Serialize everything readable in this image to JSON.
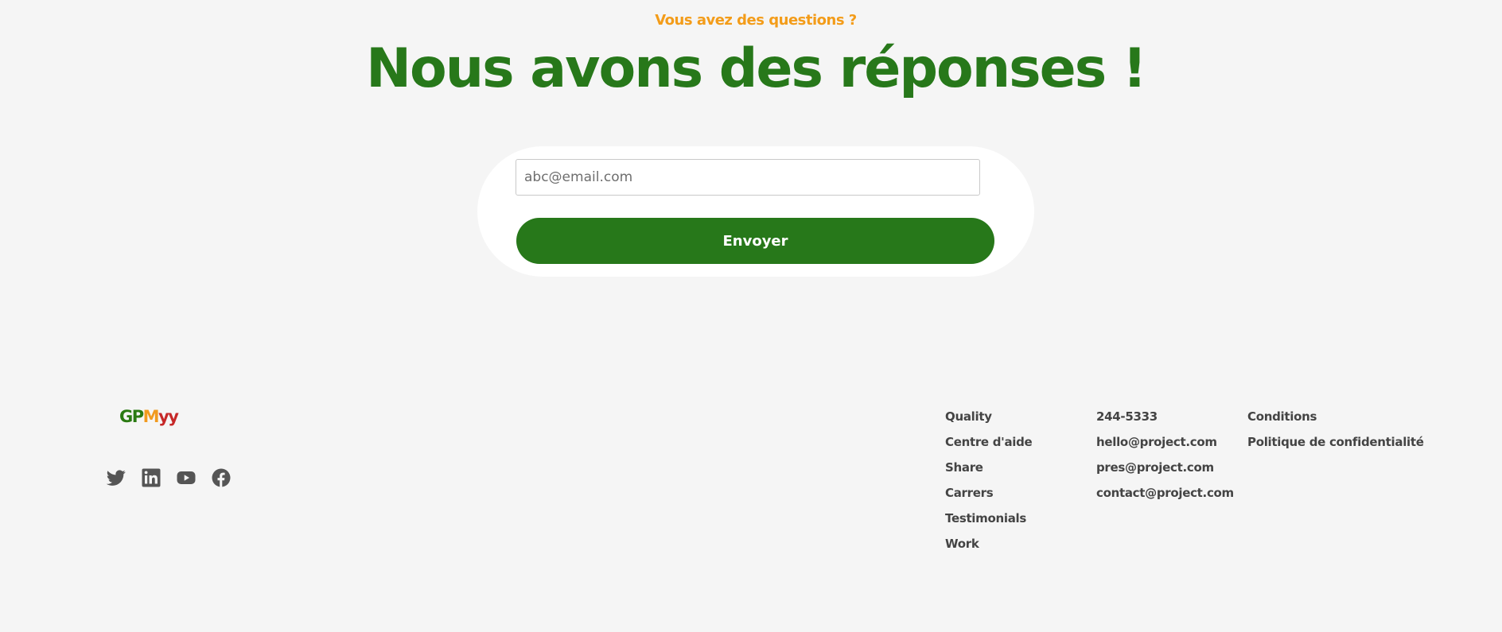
{
  "hero": {
    "eyebrow": "Vous avez des questions ?",
    "title": "Nous avons des réponses !"
  },
  "form": {
    "email_placeholder": "abc@email.com",
    "email_value": "",
    "submit_label": "Envoyer"
  },
  "footer": {
    "logo": {
      "letters": [
        "G",
        "P",
        "M",
        "y",
        "y"
      ],
      "colors": [
        "#2a7a12",
        "#2a7a12",
        "#f19a1f",
        "#c62828",
        "#c62828"
      ]
    },
    "social_icons": [
      "twitter-icon",
      "linkedin-icon",
      "youtube-icon",
      "facebook-icon"
    ],
    "links": [
      "Quality",
      "Centre d'aide",
      "Share",
      "Carrers",
      "Testimonials",
      "Work"
    ],
    "contacts": [
      "244-5333",
      "hello@project.com",
      "pres@project.com",
      "contact@project.com"
    ],
    "legal": [
      "Conditions",
      "Politique de confidentialité"
    ]
  },
  "colors": {
    "brand_green": "#27781a",
    "accent_orange": "#f39c19",
    "background": "#f5f5f5",
    "card": "#ffffff",
    "footer_text": "#444444",
    "icon": "#555555"
  }
}
